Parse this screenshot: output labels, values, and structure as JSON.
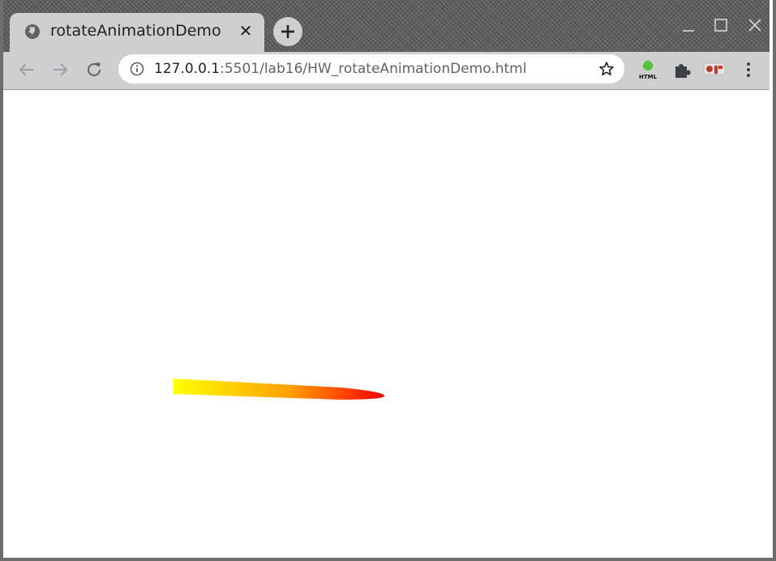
{
  "tab": {
    "title": "rotateAnimationDemo",
    "close_glyph": "✕",
    "icon": "globe-icon"
  },
  "new_tab_glyph": "+",
  "omnibox": {
    "url_host": "127.0.0.1",
    "url_path": ":5501/lab16/HW_rotateAnimationDemo.html",
    "info_icon": "info-icon",
    "star_icon": "star-icon"
  },
  "extensions": {
    "html_label": "HTML",
    "items": [
      "html-extension-icon",
      "puzzle-extensions-icon",
      "profile-extension-icon",
      "menu-dots-icon"
    ]
  },
  "canvas": {
    "shape": "rotating-bar",
    "gradient_start": "#ffff00",
    "gradient_end": "#ff0000"
  },
  "colors": {
    "frame": "#5c5c5c",
    "toolbar": "#cfcfcf",
    "page_bg": "#ffffff"
  }
}
